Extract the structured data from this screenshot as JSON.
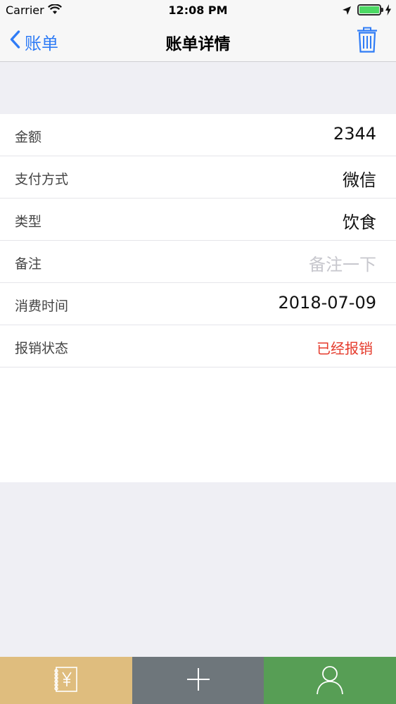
{
  "status_bar": {
    "carrier": "Carrier",
    "time": "12:08 PM",
    "icons": [
      "wifi-icon",
      "location-icon",
      "battery-icon",
      "charging-icon"
    ]
  },
  "nav": {
    "back_label": "账单",
    "title": "账单详情",
    "right_icon": "trash-icon",
    "accent_color": "#2f7cf6"
  },
  "rows": [
    {
      "label": "金额",
      "value": "2344"
    },
    {
      "label": "支付方式",
      "value": "微信"
    },
    {
      "label": "类型",
      "value": "饮食"
    },
    {
      "label": "备注",
      "placeholder": "备注一下"
    },
    {
      "label": "消费时间",
      "value": "2018-07-09"
    },
    {
      "label": "报销状态",
      "value": "已经报销",
      "value_color": "#e53b2c"
    }
  ],
  "tab_bar": {
    "tabs": [
      {
        "icon": "ledger-yen-icon",
        "color": "#dfbd7e"
      },
      {
        "icon": "plus-icon",
        "color": "#6e767b"
      },
      {
        "icon": "person-icon",
        "color": "#579e55"
      }
    ]
  }
}
